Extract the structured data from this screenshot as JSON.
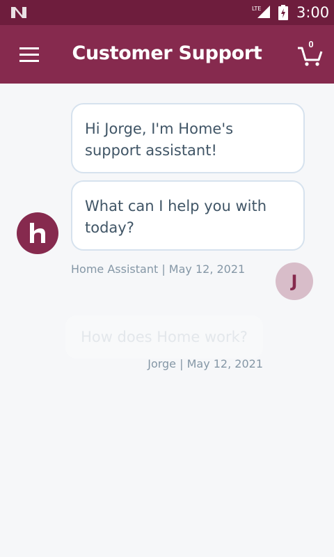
{
  "status_bar": {
    "time": "3:00",
    "network": "LTE"
  },
  "app_bar": {
    "title": "Customer Support",
    "cart_count": "0"
  },
  "messages": [
    {
      "text": "Hi Jorge, I'm Home's support assistant!"
    },
    {
      "text": "What can I help you with today?"
    }
  ],
  "bot_meta": {
    "text": "Home Assistant | May 12, 2021"
  },
  "user_message": {
    "text": "How does Home work?"
  },
  "user_meta": {
    "text": "Jorge | May 12, 2021"
  },
  "user_avatar": {
    "initial": "J"
  },
  "colors": {
    "status_bar": "#6e1d3d",
    "app_bar": "#862a4e",
    "background": "#f6f7f9",
    "avatar_user": "#d8bdc9"
  }
}
